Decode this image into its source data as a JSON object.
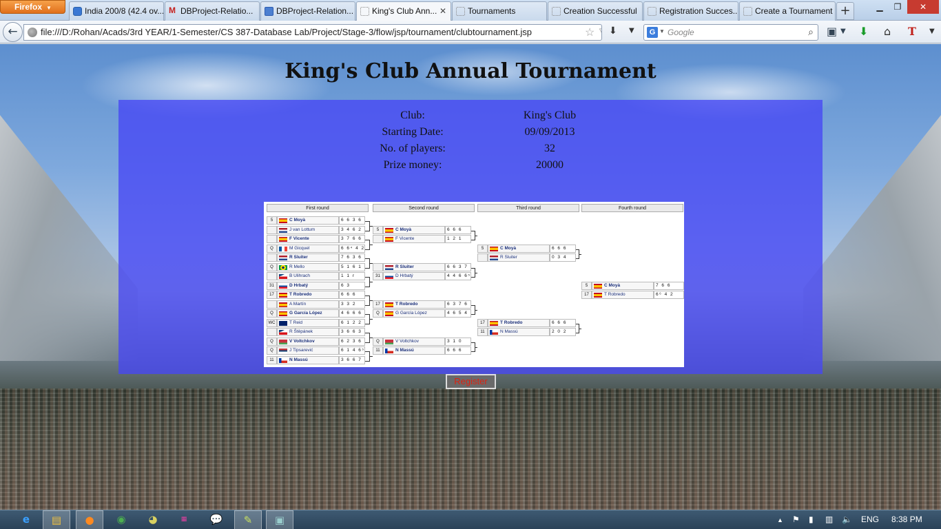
{
  "browser": {
    "menu_button": "Firefox",
    "tabs": [
      {
        "label": "India 200/8 (42.4 ov...",
        "favicon": "google-icon"
      },
      {
        "label": "DBProject-Relatio...",
        "favicon": "gmail-icon"
      },
      {
        "label": "DBProject-Relation...",
        "favicon": "docs-icon"
      },
      {
        "label": "King's Club Ann...",
        "favicon": "blank-page-icon",
        "active": true
      },
      {
        "label": "Tournaments",
        "favicon": "blank-page-icon"
      },
      {
        "label": "Creation Successful",
        "favicon": "blank-page-icon"
      },
      {
        "label": "Registration Succes...",
        "favicon": "blank-page-icon"
      },
      {
        "label": "Create a Tournament",
        "favicon": "blank-page-icon"
      }
    ],
    "new_tab": "+",
    "url": "file:///D:/Rohan/Acads/3rd YEAR/1-Semester/CS 387-Database Lab/Project/Stage-3/flow/jsp/tournament/clubtournament.jsp",
    "search_engine": "G",
    "search_placeholder": "Google"
  },
  "page": {
    "title": "King's Club Annual Tournament",
    "info": [
      {
        "label": "Club:",
        "value": "King's Club"
      },
      {
        "label": "Starting Date:",
        "value": "09/09/2013"
      },
      {
        "label": "No. of players:",
        "value": "32"
      },
      {
        "label": "Prize money:",
        "value": "20000"
      }
    ],
    "register_label": "Register"
  },
  "bracket": {
    "rounds": [
      "First round",
      "Second round",
      "Third round",
      "Fourth round"
    ],
    "first_round": [
      {
        "seed": "5",
        "name": "C Moyà",
        "flag": "es",
        "score": "6 6 3 6",
        "win": true
      },
      {
        "seed": "",
        "name": "J van Lottum",
        "flag": "nl",
        "score": "3 4 6 2",
        "win": false
      },
      {
        "seed": "",
        "name": "F Vicente",
        "flag": "es",
        "score": "3 7 6 6",
        "win": true
      },
      {
        "seed": "Q",
        "name": "M Gicquel",
        "flag": "fr",
        "score": "6 6⁴ 4 2",
        "win": false
      },
      {
        "seed": "",
        "name": "R Sluiter",
        "flag": "nl",
        "score": "7 6 3 6",
        "win": true
      },
      {
        "seed": "Q",
        "name": "R Mello",
        "flag": "br",
        "score": "5 1 6 1",
        "win": false
      },
      {
        "seed": "",
        "name": "B Ulihrach",
        "flag": "cz",
        "score": "1 1 r",
        "win": false
      },
      {
        "seed": "31",
        "name": "D Hrbatý",
        "flag": "sk",
        "score": "6 3",
        "win": true
      },
      {
        "seed": "17",
        "name": "T Robredo",
        "flag": "es",
        "score": "6 6 6",
        "win": true
      },
      {
        "seed": "",
        "name": "A Martín",
        "flag": "es",
        "score": "3 3 2",
        "win": false
      },
      {
        "seed": "Q",
        "name": "G García López",
        "flag": "es",
        "score": "4 6 6 6",
        "win": true
      },
      {
        "seed": "WC",
        "name": "T Reid",
        "flag": "au",
        "score": "6 1 2 2",
        "win": false
      },
      {
        "seed": "",
        "name": "R Štěpánek",
        "flag": "cz",
        "score": "3 6 6 3 9",
        "win": false
      },
      {
        "seed": "Q",
        "name": "V Voltchkov",
        "flag": "by",
        "score": "6 2 3 6 11",
        "win": true
      },
      {
        "seed": "Q",
        "name": "J Tipsarević",
        "flag": "rs",
        "score": "6 1 4 6⁵",
        "win": false
      },
      {
        "seed": "11",
        "name": "N Massú",
        "flag": "cl",
        "score": "3 6 6 7",
        "win": true
      }
    ],
    "second_round": [
      {
        "seed": "5",
        "name": "C Moyà",
        "flag": "es",
        "score": "6 6 6",
        "win": true
      },
      {
        "seed": "",
        "name": "F Vicente",
        "flag": "es",
        "score": "1 2 1",
        "win": false
      },
      {
        "seed": "",
        "name": "R Sluiter",
        "flag": "nl",
        "score": "6 6 3 7",
        "win": true
      },
      {
        "seed": "31",
        "name": "D Hrbatý",
        "flag": "sk",
        "score": "4 4 6 6⁵",
        "win": false
      },
      {
        "seed": "17",
        "name": "T Robredo",
        "flag": "es",
        "score": "6 3 7 6",
        "win": true
      },
      {
        "seed": "Q",
        "name": "G García López",
        "flag": "es",
        "score": "4 6 5 4",
        "win": false
      },
      {
        "seed": "Q",
        "name": "V Voltchkov",
        "flag": "by",
        "score": "3 1 0",
        "win": false
      },
      {
        "seed": "11",
        "name": "N Massú",
        "flag": "cl",
        "score": "6 6 6",
        "win": true
      }
    ],
    "third_round": [
      {
        "seed": "5",
        "name": "C Moyà",
        "flag": "es",
        "score": "6 6 6",
        "win": true
      },
      {
        "seed": "",
        "name": "R Sluiter",
        "flag": "nl",
        "score": "0 3 4",
        "win": false
      },
      {
        "seed": "17",
        "name": "T Robredo",
        "flag": "es",
        "score": "6 6 6",
        "win": true
      },
      {
        "seed": "11",
        "name": "N Massú",
        "flag": "cl",
        "score": "2 0 2",
        "win": false
      }
    ],
    "fourth_round": [
      {
        "seed": "5",
        "name": "C Moyà",
        "flag": "es",
        "score": "7 6 6",
        "win": true
      },
      {
        "seed": "17",
        "name": "T Robredo",
        "flag": "es",
        "score": "6⁶ 4 2",
        "win": false
      }
    ]
  },
  "taskbar": {
    "language": "ENG",
    "time": "8:38 PM"
  }
}
